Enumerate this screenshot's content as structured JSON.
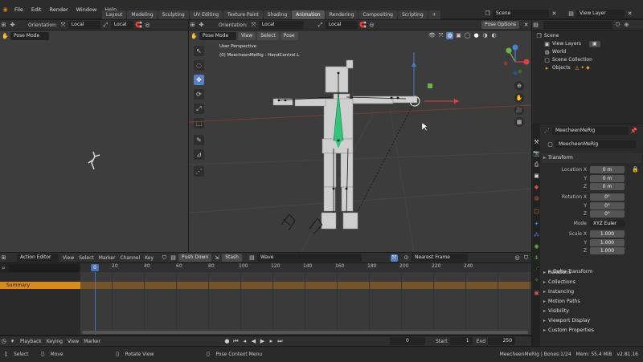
{
  "menu": {
    "items": [
      "File",
      "Edit",
      "Render",
      "Window",
      "Help"
    ]
  },
  "workspaces": {
    "tabs": [
      "Layout",
      "Modeling",
      "Sculpting",
      "UV Editing",
      "Texture Paint",
      "Shading",
      "Animation",
      "Rendering",
      "Compositing",
      "Scripting"
    ],
    "active": "Animation",
    "add": "+"
  },
  "scene": {
    "value": "Scene"
  },
  "view_layer": {
    "value": "View Layer"
  },
  "left_view": {
    "mode": "Pose Mode",
    "orientation_label": "Orientation:",
    "orientation": "Local",
    "pivot": "Local"
  },
  "main_view": {
    "mode": "Pose Mode",
    "menus": [
      "View",
      "Select",
      "Pose"
    ],
    "orientation_label": "Orientation:",
    "orientation": "Local",
    "pivot": "Local",
    "pose_options": "Pose Options",
    "overlay_title": "User Perspective",
    "overlay_sub": "(0) MeecheenMeRig : HandControl.L"
  },
  "outliner": {
    "items": [
      {
        "label": "Scene",
        "icon": "scene-icon"
      },
      {
        "label": "View Layers",
        "icon": "image-icon"
      },
      {
        "label": "World",
        "icon": "world-icon"
      },
      {
        "label": "Scene Collection",
        "icon": "collection-icon"
      },
      {
        "label": "Objects",
        "icon": "object-icon"
      }
    ]
  },
  "properties": {
    "object_name": "MeecheenMeRig",
    "data_name": "MeecheenMeRig",
    "transform_label": "Transform",
    "location_label": "Location X",
    "rotation_label": "Rotation X",
    "mode_label": "Mode",
    "mode_value": "XYZ Euler",
    "scale_label": "Scale X",
    "y": "Y",
    "z": "Z",
    "location": [
      "0 m",
      "0 m",
      "0 m"
    ],
    "rotation": [
      "0°",
      "0°",
      "0°"
    ],
    "scale": [
      "1.000",
      "1.000",
      "1.000"
    ],
    "delta": "Delta Transform",
    "panels": [
      "Relations",
      "Collections",
      "Instancing",
      "Motion Paths",
      "Visibility",
      "Viewport Display",
      "Custom Properties"
    ]
  },
  "action_editor": {
    "type": "Action Editor",
    "menus": [
      "View",
      "Select",
      "Marker",
      "Channel",
      "Key"
    ],
    "push_down": "Push Down",
    "stash": "Stash",
    "action": "Wave",
    "snap": "Nearest Frame",
    "summary": "Summary",
    "current_frame": "0",
    "ticks": [
      "0",
      "20",
      "40",
      "60",
      "80",
      "100",
      "120",
      "140",
      "160",
      "180",
      "200",
      "220",
      "240"
    ]
  },
  "timeline": {
    "menus": [
      "Playback",
      "Keying",
      "View",
      "Marker"
    ],
    "frame": "0",
    "start_label": "Start",
    "start": "1",
    "end_label": "End",
    "end": "250"
  },
  "status": {
    "select": "Select",
    "move": "Move",
    "rotate": "Rotate View",
    "context": "Pose Context Menu",
    "info": "MeecheenMeRig | Bones:1/24",
    "mem": "Mem: 55.4 MiB",
    "version": "v2.81.16"
  },
  "colors": {
    "accent": "#5680c2",
    "summary": "#d98a1f",
    "playhead": "#4772b3"
  }
}
